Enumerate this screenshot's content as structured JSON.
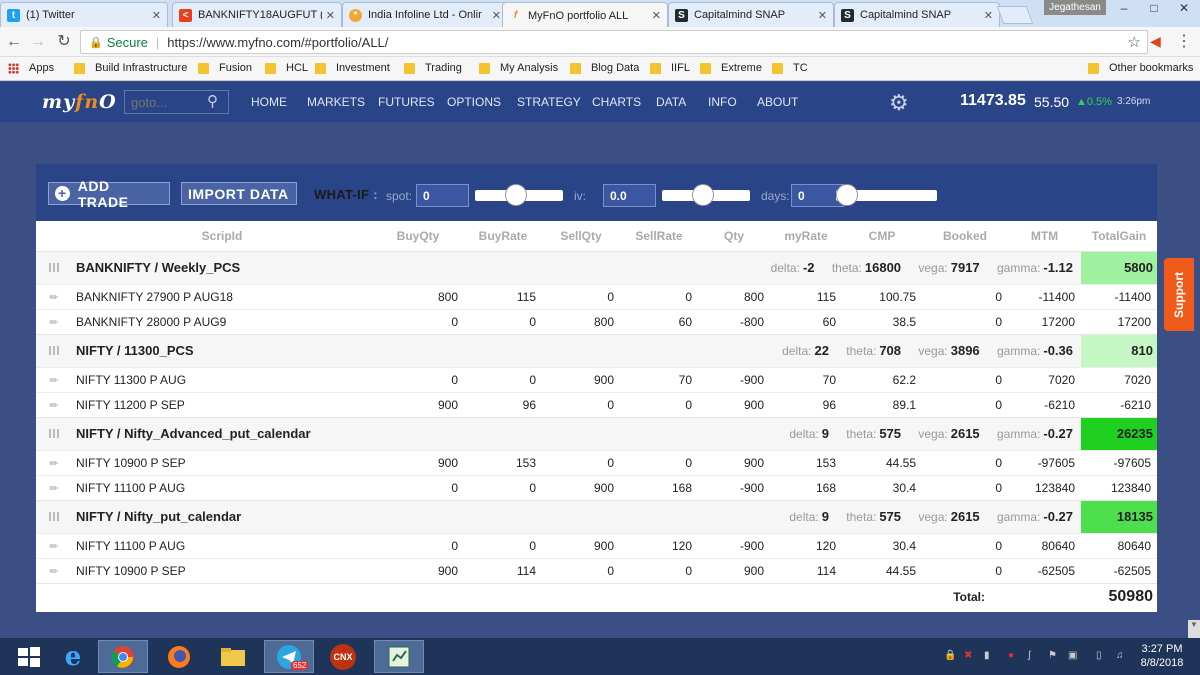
{
  "browser": {
    "tabs": [
      {
        "label": "(1) Twitter",
        "icon": "twitter-icon"
      },
      {
        "label": "BANKNIFTY18AUGFUT (",
        "icon": "chart-icon"
      },
      {
        "label": "India Infoline Ltd - Onlir",
        "icon": "iifl-icon"
      },
      {
        "label": "MyFnO portfolio ALL",
        "icon": "myfno-icon"
      },
      {
        "label": "Capitalmind SNAP",
        "icon": "capitalmind-icon"
      },
      {
        "label": "Capitalmind SNAP",
        "icon": "capitalmind-icon"
      }
    ],
    "user": "Jegathesan",
    "secure_label": "Secure",
    "url": "https://www.myfno.com/#portfolio/ALL/",
    "bookmarks": [
      "Apps",
      "Build Infrastructure",
      "Fusion",
      "HCL",
      "Investment",
      "Trading",
      "My Analysis",
      "Blog Data",
      "IIFL",
      "Extreme",
      "TC"
    ],
    "other_bookmarks": "Other bookmarks"
  },
  "site": {
    "logo": {
      "a": "my",
      "b": "fn",
      "c": "O"
    },
    "goto_placeholder": "goto...",
    "nav": [
      "HOME",
      "MARKETS",
      "FUTURES",
      "OPTIONS",
      "STRATEGY",
      "CHARTS",
      "DATA",
      "INFO",
      "ABOUT"
    ],
    "index_value": "11473.85",
    "index_change": "55.50",
    "index_pct": "▲0.5%",
    "index_time": "3:26pm"
  },
  "toolbar": {
    "add_trade": "ADD TRADE",
    "import_data": "IMPORT DATA",
    "whatif": "WHAT-IF",
    "spot_label": "spot:",
    "spot_value": "0",
    "iv_label": "iv:",
    "iv_value": "0.0",
    "days_label": "days:",
    "days_value": "0"
  },
  "table": {
    "headers": [
      "ScripId",
      "BuyQty",
      "BuyRate",
      "SellQty",
      "SellRate",
      "Qty",
      "myRate",
      "CMP",
      "Booked",
      "MTM",
      "TotalGain"
    ],
    "groups": [
      {
        "name": "BANKNIFTY / Weekly_PCS",
        "delta": "-2",
        "theta": "16800",
        "vega": "7917",
        "gamma": "-1.12",
        "total": "5800",
        "total_color": "#9ff09f",
        "legs": [
          [
            "BANKNIFTY 27900 P AUG18",
            "800",
            "115",
            "0",
            "0",
            "800",
            "115",
            "100.75",
            "0",
            "-11400",
            "-11400"
          ],
          [
            "BANKNIFTY 28000 P AUG9",
            "0",
            "0",
            "800",
            "60",
            "-800",
            "60",
            "38.5",
            "0",
            "17200",
            "17200"
          ]
        ]
      },
      {
        "name": "NIFTY / 11300_PCS",
        "delta": "22",
        "theta": "708",
        "vega": "3896",
        "gamma": "-0.36",
        "total": "810",
        "total_color": "#c5f7c5",
        "legs": [
          [
            "NIFTY 11300 P AUG",
            "0",
            "0",
            "900",
            "70",
            "-900",
            "70",
            "62.2",
            "0",
            "7020",
            "7020"
          ],
          [
            "NIFTY 11200 P SEP",
            "900",
            "96",
            "0",
            "0",
            "900",
            "96",
            "89.1",
            "0",
            "-6210",
            "-6210"
          ]
        ]
      },
      {
        "name": "NIFTY / Nifty_Advanced_put_calendar",
        "delta": "9",
        "theta": "575",
        "vega": "2615",
        "gamma": "-0.27",
        "total": "26235",
        "total_color": "#20d020",
        "legs": [
          [
            "NIFTY 10900 P SEP",
            "900",
            "153",
            "0",
            "0",
            "900",
            "153",
            "44.55",
            "0",
            "-97605",
            "-97605"
          ],
          [
            "NIFTY 11100 P AUG",
            "0",
            "0",
            "900",
            "168",
            "-900",
            "168",
            "30.4",
            "0",
            "123840",
            "123840"
          ]
        ]
      },
      {
        "name": "NIFTY / Nifty_put_calendar",
        "delta": "9",
        "theta": "575",
        "vega": "2615",
        "gamma": "-0.27",
        "total": "18135",
        "total_color": "#4ddf4d",
        "legs": [
          [
            "NIFTY 11100 P AUG",
            "0",
            "0",
            "900",
            "120",
            "-900",
            "120",
            "30.4",
            "0",
            "80640",
            "80640"
          ],
          [
            "NIFTY 10900 P SEP",
            "900",
            "114",
            "0",
            "0",
            "900",
            "114",
            "44.55",
            "0",
            "-62505",
            "-62505"
          ]
        ]
      }
    ],
    "greek_labels": {
      "delta": "delta:",
      "theta": "theta:",
      "vega": "vega:",
      "gamma": "gamma:"
    },
    "total_label": "Total:",
    "total_value": "50980"
  },
  "support_label": "Support",
  "taskbar": {
    "apps": [
      "windows-start-icon",
      "ie-icon",
      "chrome-icon",
      "firefox-icon",
      "explorer-icon",
      "telegram-icon",
      "cnx-icon",
      "excel-icon"
    ],
    "telegram_badge": "652",
    "cnx_label": "CNX",
    "time": "3:27 PM",
    "date": "8/8/2018"
  }
}
